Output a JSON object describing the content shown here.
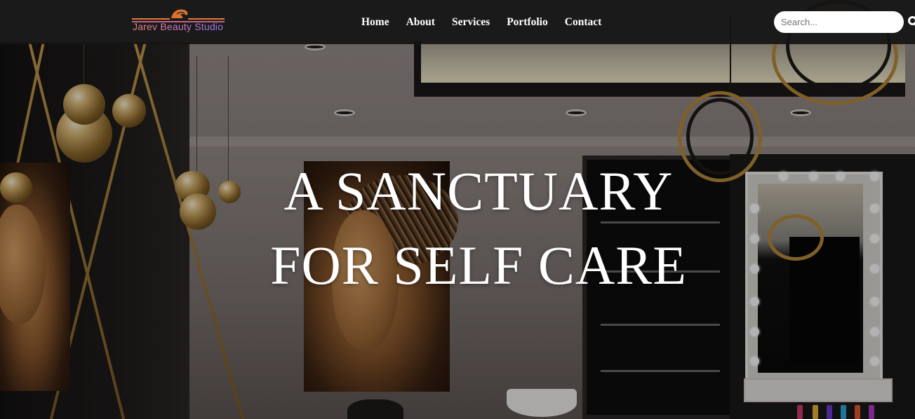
{
  "brand": {
    "name": "Jarev Beauty Studio",
    "colors": {
      "orange": "#e07a3a",
      "pink": "#c9608e",
      "purple": "#8e7cf0"
    },
    "icon": "hair-silhouette-icon"
  },
  "nav": {
    "items": [
      {
        "label": "Home"
      },
      {
        "label": "About"
      },
      {
        "label": "Services"
      },
      {
        "label": "Portfolio"
      },
      {
        "label": "Contact"
      }
    ]
  },
  "search": {
    "placeholder": "Search...",
    "value": "",
    "button_icon": "search-icon"
  },
  "hero": {
    "line1": "A SANCTUARY",
    "line2": "FOR SELF CARE",
    "background": "salon-interior-image"
  },
  "theme": {
    "navbar_bg": "#161414",
    "text": "#ffffff"
  }
}
